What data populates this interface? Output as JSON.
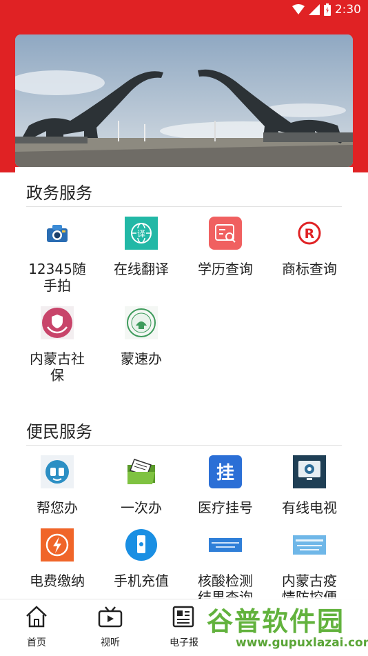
{
  "status": {
    "time": "2:30"
  },
  "colors": {
    "brand_red": "#e02224",
    "watermark_green": "#62b23d"
  },
  "sections": [
    {
      "title": "政务服务",
      "items": [
        {
          "label": "12345随\n手拍",
          "icon": "camera-icon"
        },
        {
          "label": "在线翻译",
          "icon": "globe-translate-icon"
        },
        {
          "label": "学历查询",
          "icon": "certificate-search-icon"
        },
        {
          "label": "商标查询",
          "icon": "registered-trademark-icon"
        },
        {
          "label": "内蒙古社\n保",
          "icon": "social-security-hands-icon"
        },
        {
          "label": "蒙速办",
          "icon": "mengsuban-logo-icon"
        }
      ]
    },
    {
      "title": "便民服务",
      "items": [
        {
          "label": "帮您办",
          "icon": "help-handle-icon"
        },
        {
          "label": "一次办",
          "icon": "folder-document-icon"
        },
        {
          "label": "医疗挂号",
          "icon": "medical-register-icon"
        },
        {
          "label": "有线电视",
          "icon": "cable-tv-icon"
        },
        {
          "label": "电费缴纳",
          "icon": "lightning-icon"
        },
        {
          "label": "手机充值",
          "icon": "phone-recharge-icon"
        },
        {
          "label": "核酸检测\n结果查询",
          "icon": "nucleic-test-banner-icon"
        },
        {
          "label": "内蒙古疫\n情防控便",
          "icon": "epidemic-banner-icon"
        }
      ]
    }
  ],
  "bottom_nav": [
    {
      "label": "首页",
      "icon": "home-icon"
    },
    {
      "label": "视听",
      "icon": "video-icon"
    },
    {
      "label": "电子报",
      "icon": "newspaper-icon"
    }
  ],
  "watermark": {
    "main": "谷普软件园",
    "url": "www.gupuxlazai.com"
  }
}
